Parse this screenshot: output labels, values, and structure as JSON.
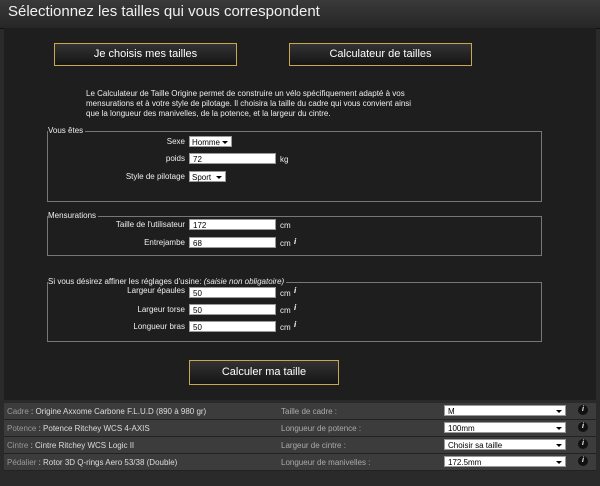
{
  "header": {
    "title": "Sélectionnez les tailles qui vous correspondent"
  },
  "buttons": {
    "choose_sizes": "Je choisis mes tailles",
    "calculator": "Calculateur de tailles",
    "calculate": "Calculer ma taille"
  },
  "intro": "Le Calculateur de Taille Origine permet de construire un vélo spécifiquement adapté à vos mensurations et à votre style de pilotage. Il choisira la taille du cadre qui vous convient ainsi que la longueur des manivelles, de la potence, et la largeur du cintre.",
  "vous_etes": {
    "legend": "Vous êtes",
    "sexe_label": "Sexe",
    "sexe_value": "Homme",
    "poids_label": "poids",
    "poids_value": "72",
    "poids_unit": "kg",
    "style_label": "Style de pilotage",
    "style_value": "Sport"
  },
  "mensurations": {
    "legend": "Mensurations",
    "taille_label": "Taille de l'utilisateur",
    "taille_value": "172",
    "taille_unit": "cm",
    "entrejambe_label": "Entrejambe",
    "entrejambe_value": "68",
    "entrejambe_unit": "cm"
  },
  "affiner": {
    "legend": "Si vous désirez affiner les réglages d'usine:",
    "legend_note": "(saisie non obligatoire)",
    "epaules_label": "Largeur épaules",
    "epaules_value": "50",
    "epaules_unit": "cm",
    "torse_label": "Largeur torse",
    "torse_value": "50",
    "torse_unit": "cm",
    "bras_label": "Longueur bras",
    "bras_value": "50",
    "bras_unit": "cm"
  },
  "info_glyph": "i",
  "components": [
    {
      "key": "Cadre",
      "value": "Origine Axxome Carbone F.L.U.D (890 à 980 gr)",
      "param": "Taille de cadre :",
      "selected": "M"
    },
    {
      "key": "Potence",
      "value": "Potence Ritchey WCS 4-AXIS",
      "param": "Longueur de potence :",
      "selected": "100mm"
    },
    {
      "key": "Cintre",
      "value": "Cintre Ritchey WCS Logic II",
      "param": "Largeur de cintre :",
      "selected": "Choisir sa taille"
    },
    {
      "key": "Pédalier",
      "value": "Rotor 3D Q-rings Aero 53/38 (Double)",
      "param": "Longueur de manivelles :",
      "selected": "172.5mm"
    }
  ]
}
